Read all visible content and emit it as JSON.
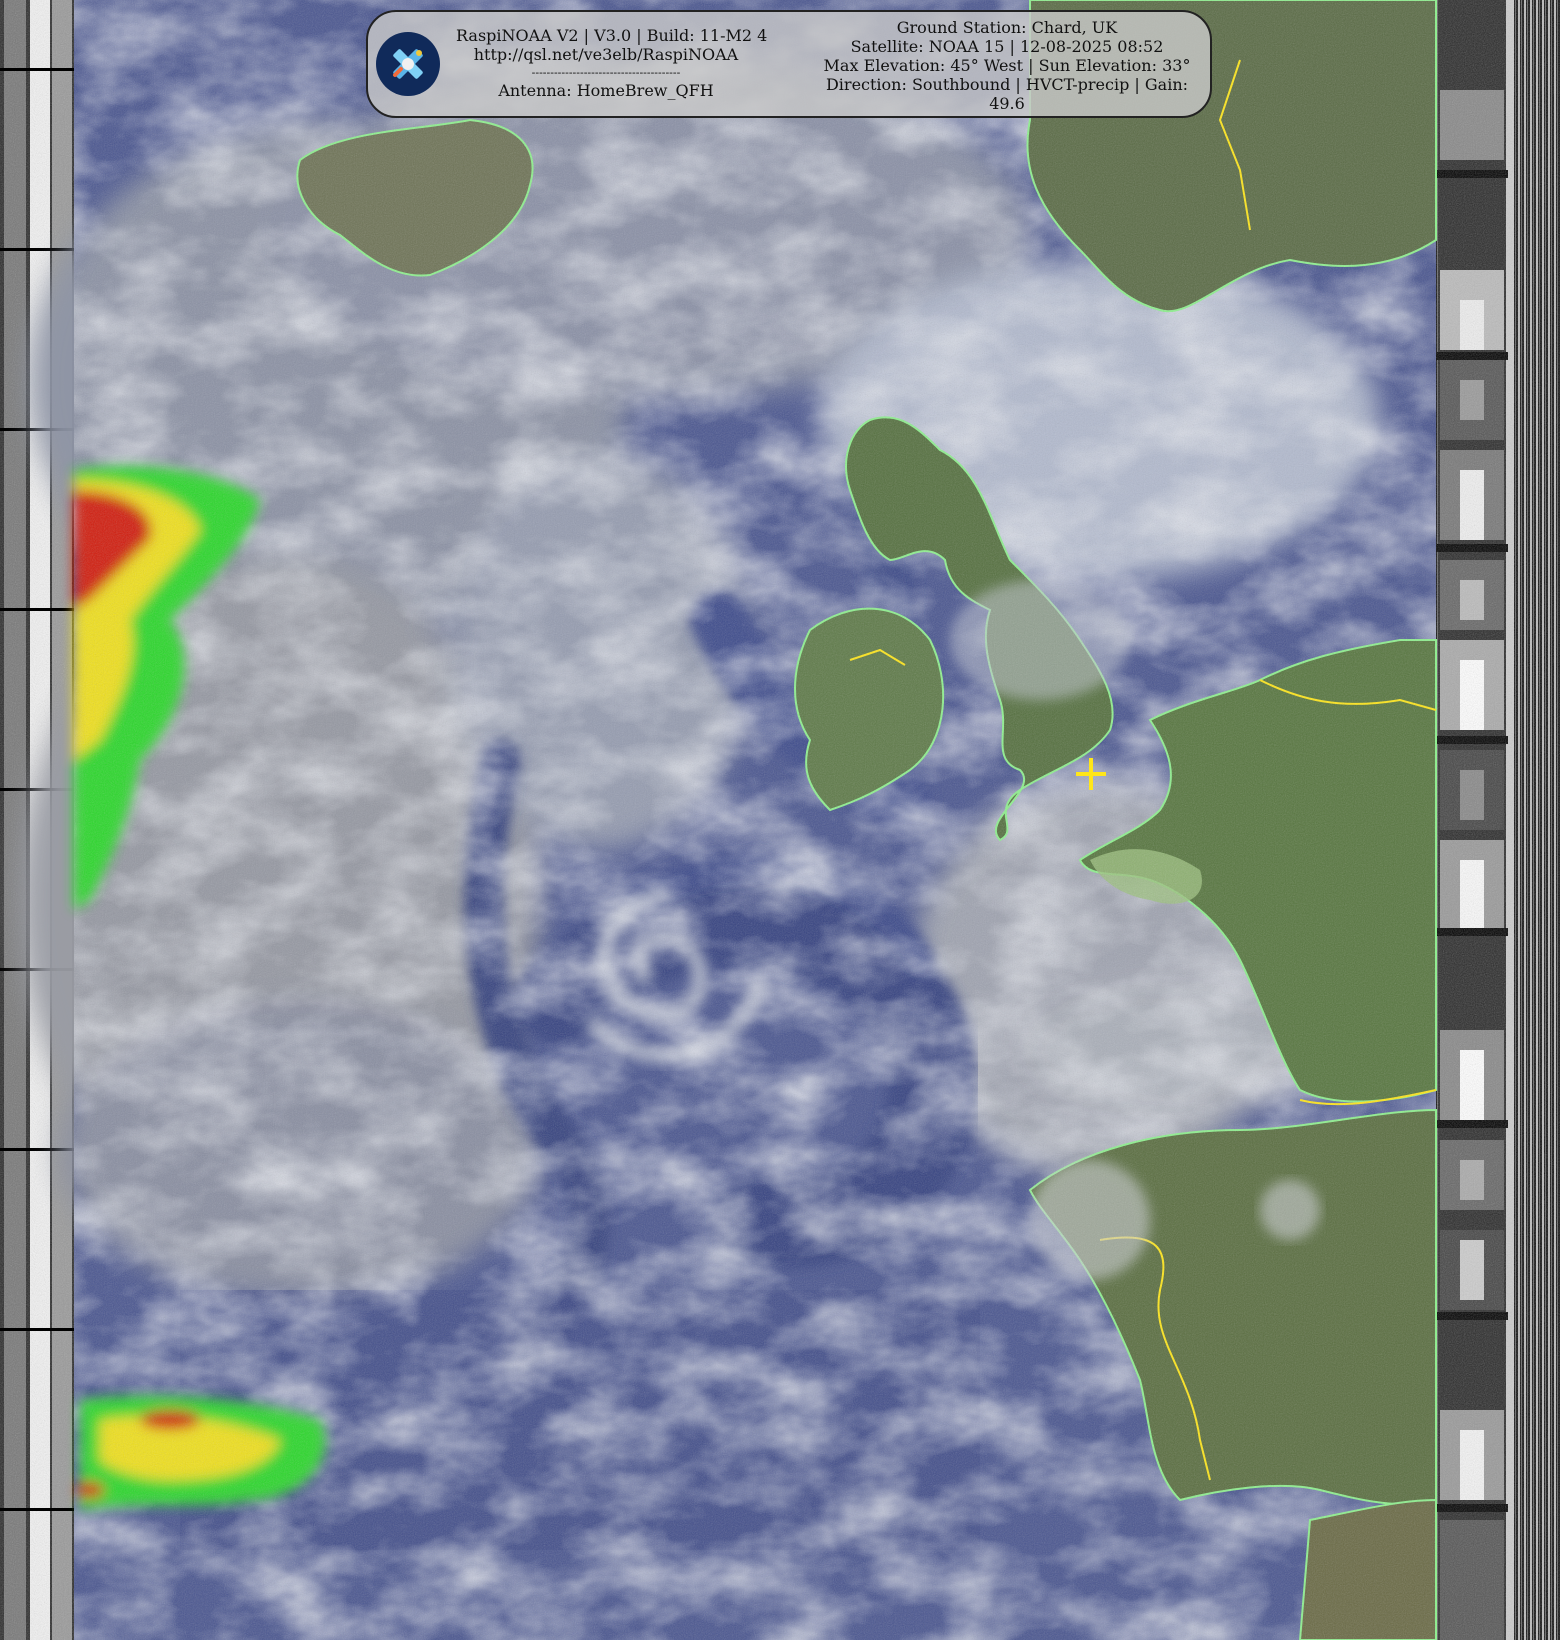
{
  "info_panel": {
    "app_line": "RaspiNOAA V2 | V3.0 | Build: 11-M2 4",
    "url_line": "http://qsl.net/ve3elb/RaspiNOAA",
    "separator": "----------------------------------------",
    "antenna_line": "Antenna: HomeBrew_QFH",
    "ground_station": "Ground Station: Chard, UK",
    "satellite_line": "Satellite: NOAA 15 | 12-08-2025 08:52",
    "elevation_line": "Max Elevation: 45° West | Sun Elevation: 33°",
    "direction_line": "Direction: Southbound | HVCT-precip | Gain: 49.6"
  },
  "colors": {
    "coastline": "#8ef08e",
    "border": "#ffe619",
    "marker": "#ffe619",
    "ocean": "#3a4a86",
    "cloud": "#a8adb8",
    "land": "#5e7f4e",
    "precip_heavy": "#d21a0a",
    "precip_mid": "#f0e01a",
    "precip_light": "#2cd82c"
  },
  "icons": {
    "logo": "satellite-icon",
    "marker": "ground-station-cross-icon"
  }
}
